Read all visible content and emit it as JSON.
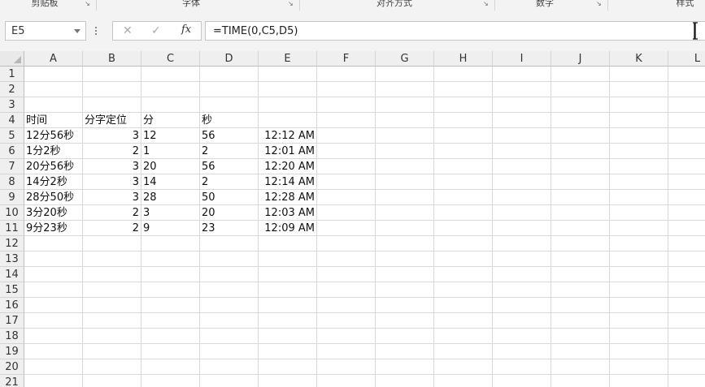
{
  "ribbon": {
    "groups": [
      "剪贴板",
      "字体",
      "对齐方式",
      "数字",
      "样式"
    ],
    "launcher_icon": "dialog-launcher-icon"
  },
  "formula_bar": {
    "name_box": "E5",
    "cancel_icon": "✕",
    "enter_icon": "✓",
    "fx_label": "fx",
    "formula": "=TIME(0,C5,D5)"
  },
  "columns": [
    "A",
    "B",
    "C",
    "D",
    "E",
    "F",
    "G",
    "H",
    "I",
    "J",
    "K",
    "L"
  ],
  "rows": [
    "1",
    "2",
    "3",
    "4",
    "5",
    "6",
    "7",
    "8",
    "9",
    "10",
    "11",
    "12",
    "13",
    "14",
    "15",
    "16",
    "17",
    "18",
    "19",
    "20",
    "21"
  ],
  "sheet": {
    "header": {
      "a": "时间",
      "b": "分字定位",
      "c": "分",
      "d": "秒"
    },
    "data": [
      {
        "a": "12分56秒",
        "b": "3",
        "c": "12",
        "d": "56",
        "e": "12:12 AM"
      },
      {
        "a": "1分2秒",
        "b": "2",
        "c": "1",
        "d": "2",
        "e": "12:01 AM"
      },
      {
        "a": "20分56秒",
        "b": "3",
        "c": "20",
        "d": "56",
        "e": "12:20 AM"
      },
      {
        "a": "14分2秒",
        "b": "3",
        "c": "14",
        "d": "2",
        "e": "12:14 AM"
      },
      {
        "a": "28分50秒",
        "b": "3",
        "c": "28",
        "d": "50",
        "e": "12:28 AM"
      },
      {
        "a": "3分20秒",
        "b": "2",
        "c": "3",
        "d": "20",
        "e": "12:03 AM"
      },
      {
        "a": "9分23秒",
        "b": "2",
        "c": "9",
        "d": "23",
        "e": "12:09 AM"
      }
    ]
  }
}
